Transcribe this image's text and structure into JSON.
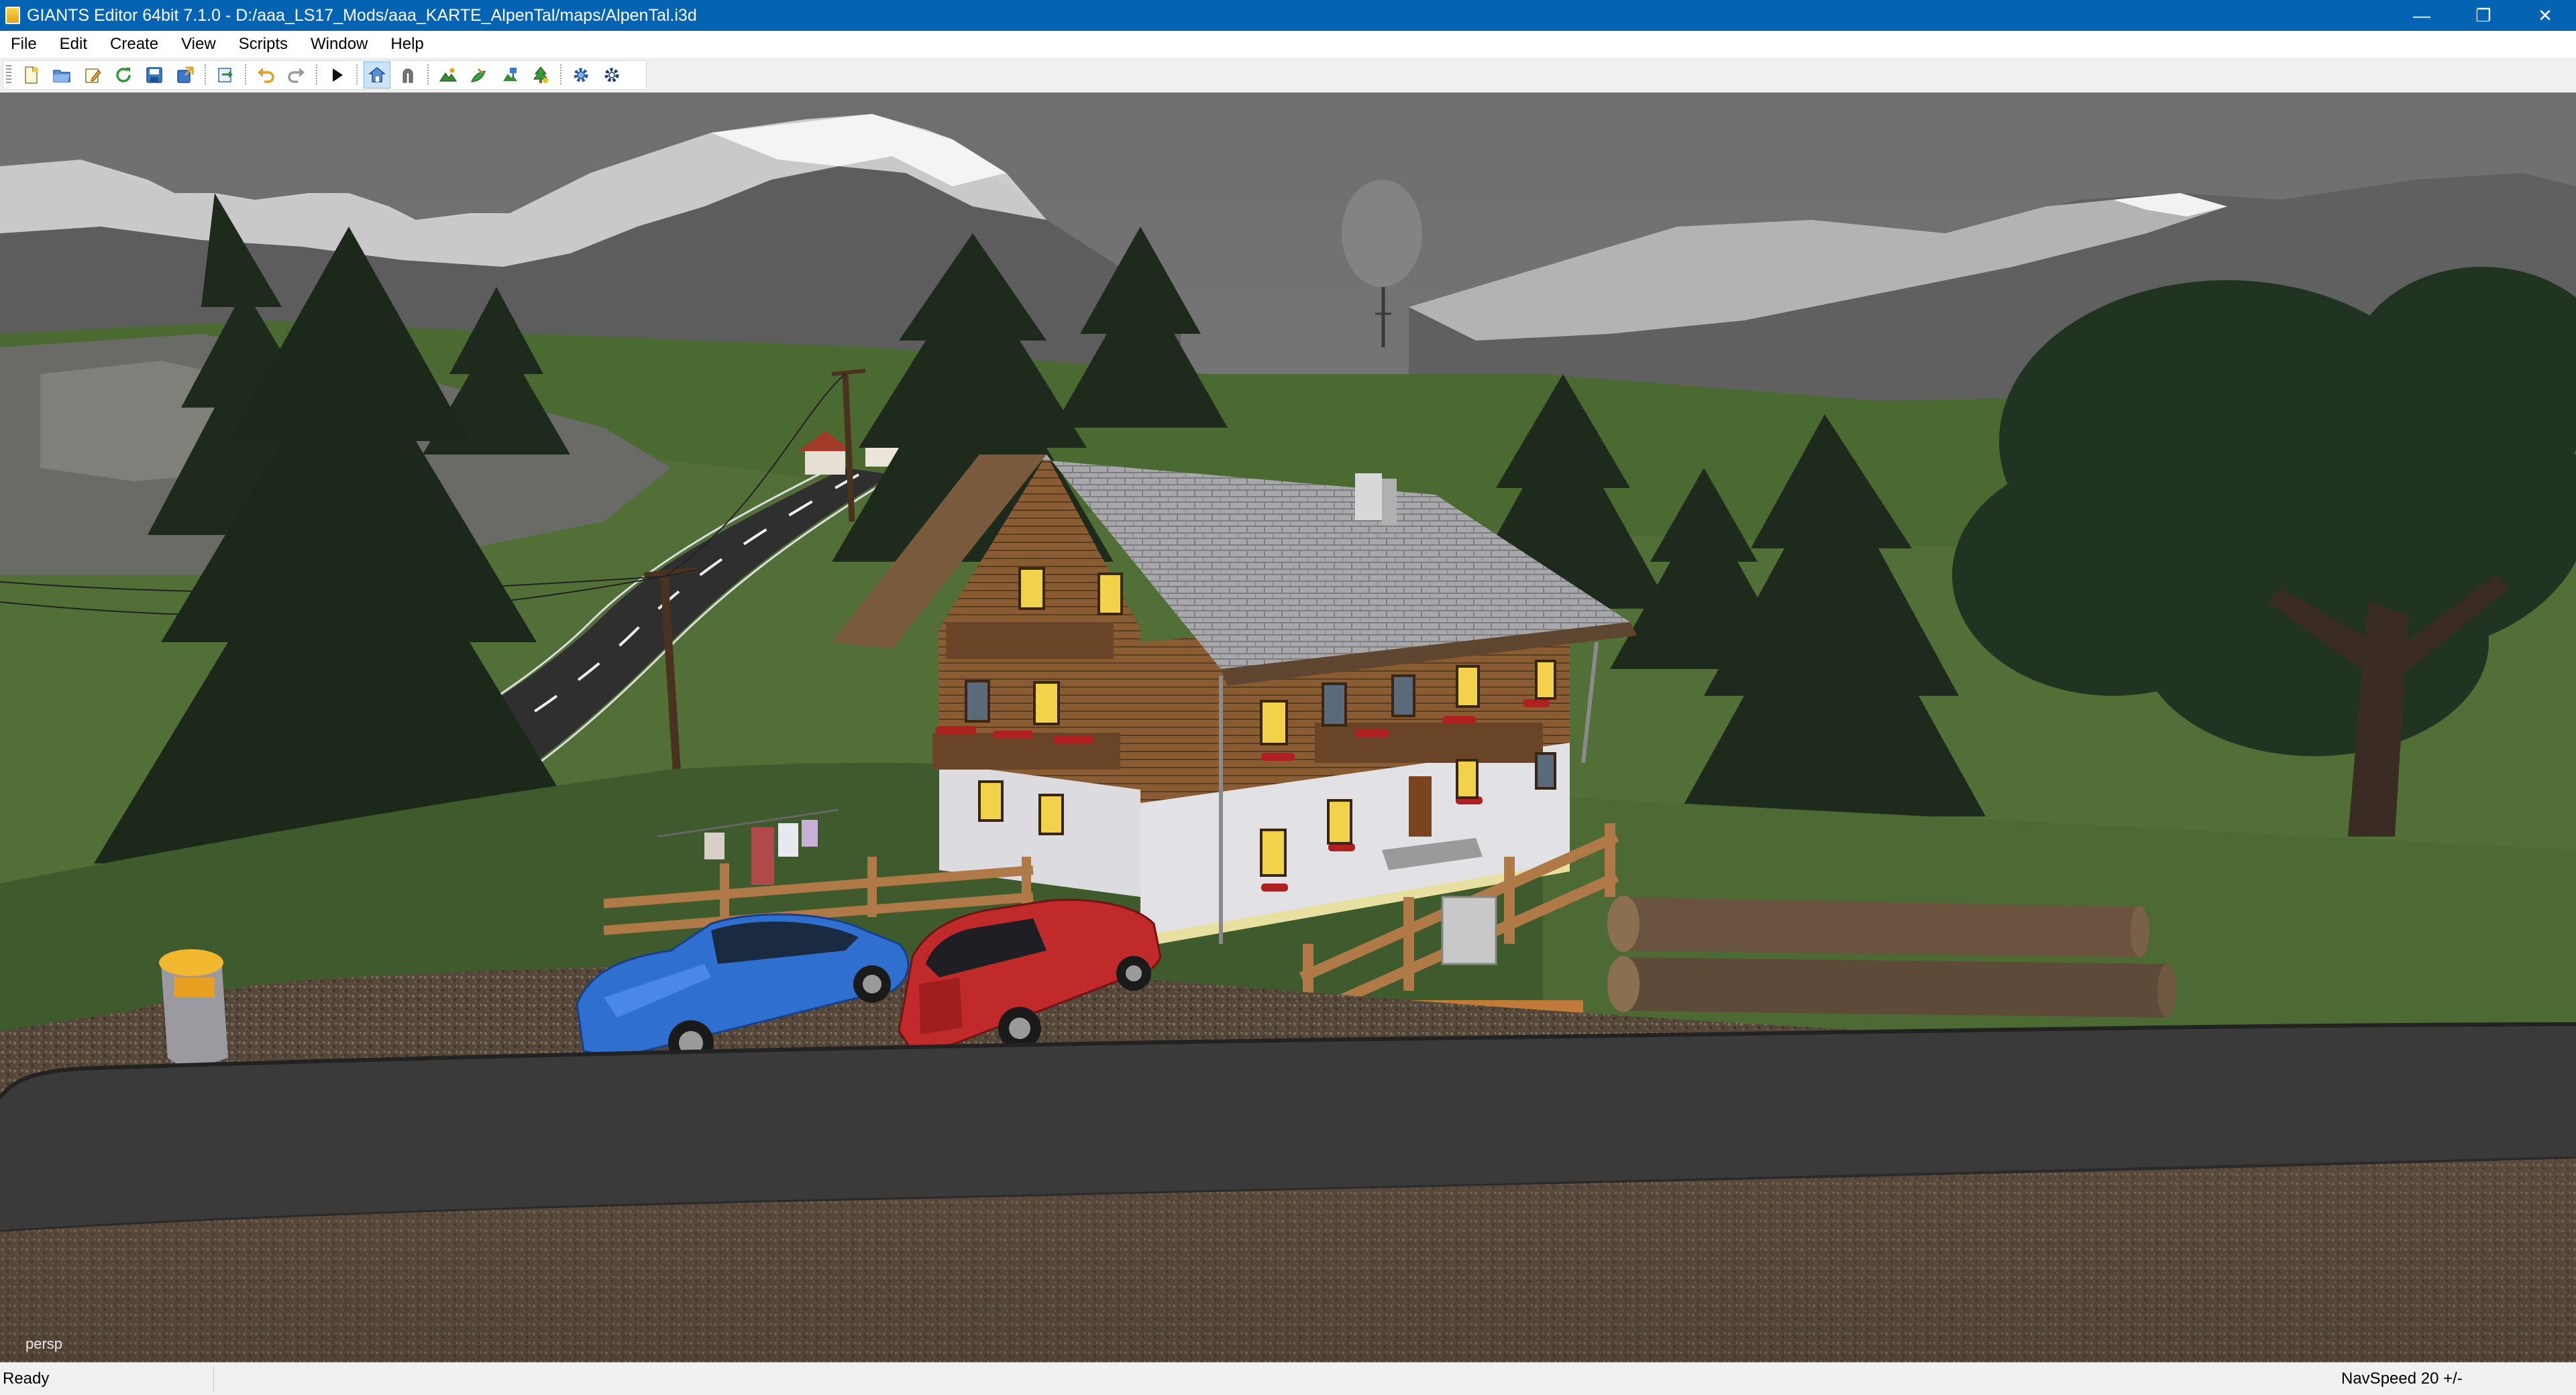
{
  "window": {
    "title": "GIANTS Editor 64bit 7.1.0 - D:/aaa_LS17_Mods/aaa_KARTE_AlpenTal/maps/AlpenTal.i3d",
    "controls": {
      "minimize": "—",
      "restore": "❐",
      "close": "✕"
    }
  },
  "menu": {
    "items": [
      {
        "label": "File"
      },
      {
        "label": "Edit"
      },
      {
        "label": "Create"
      },
      {
        "label": "View"
      },
      {
        "label": "Scripts"
      },
      {
        "label": "Window"
      },
      {
        "label": "Help"
      }
    ]
  },
  "toolbar": {
    "icons": [
      "new-file-icon",
      "open-folder-icon",
      "edit-icon",
      "refresh-icon",
      "save-icon",
      "export-icon",
      "import-icon",
      "undo-icon",
      "redo-icon",
      "play-icon",
      "move-tool-icon",
      "magnet-icon",
      "terrain-paint-icon",
      "foliage-icon",
      "object-place-icon",
      "tree-icon",
      "settings-gear-icon",
      "scripts-gear-icon"
    ]
  },
  "viewport": {
    "camera_label": "persp"
  },
  "status": {
    "left": "Ready",
    "right": "NavSpeed 20 +/-"
  },
  "colors": {
    "titlebar": "#0563b4",
    "sky": "#7b7b7b",
    "road": "#3a3a3a",
    "gravel": "#5a4a3a",
    "car_blue": "#2f6fd0",
    "car_red": "#c02a2a"
  }
}
